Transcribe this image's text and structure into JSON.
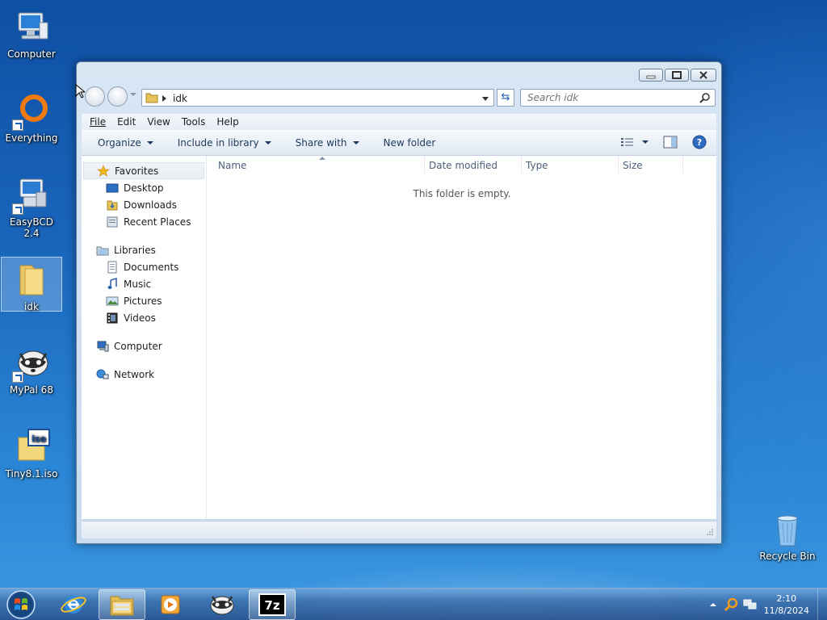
{
  "desktop": {
    "icons": [
      {
        "label": "Computer",
        "icon": "computer-icon"
      },
      {
        "label": "Everything",
        "icon": "everything-icon"
      },
      {
        "label": "EasyBCD 2.4",
        "icon": "easybcd-icon"
      },
      {
        "label": "idk",
        "icon": "folder-icon"
      },
      {
        "label": "MyPal 68",
        "icon": "mypal-icon"
      },
      {
        "label": "Tiny8.1.iso",
        "icon": "iso-file-icon"
      },
      {
        "label": "Recycle Bin",
        "icon": "recycle-bin-icon"
      }
    ]
  },
  "window": {
    "address": {
      "crumb": "idk"
    },
    "search": {
      "placeholder": "Search idk"
    },
    "menu": [
      "File",
      "Edit",
      "View",
      "Tools",
      "Help"
    ],
    "commands": [
      "Organize",
      "Include in library",
      "Share with",
      "New folder"
    ],
    "nav": {
      "favorites": {
        "label": "Favorites",
        "items": [
          "Desktop",
          "Downloads",
          "Recent Places"
        ]
      },
      "libraries": {
        "label": "Libraries",
        "items": [
          "Documents",
          "Music",
          "Pictures",
          "Videos"
        ]
      },
      "computer": "Computer",
      "network": "Network"
    },
    "columns": [
      "Name",
      "Date modified",
      "Type",
      "Size"
    ],
    "empty_message": "This folder is empty."
  },
  "taskbar": {
    "time": "2:10",
    "date": "11/8/2024",
    "buttons": [
      "internet-explorer-icon",
      "windows-explorer-icon",
      "media-player-icon",
      "mypal-icon",
      "7zip-icon"
    ]
  },
  "colors": {
    "accent": "#1d5fbf",
    "desktop_top": "#0e4fa3",
    "desktop_bottom": "#3c98e0"
  }
}
